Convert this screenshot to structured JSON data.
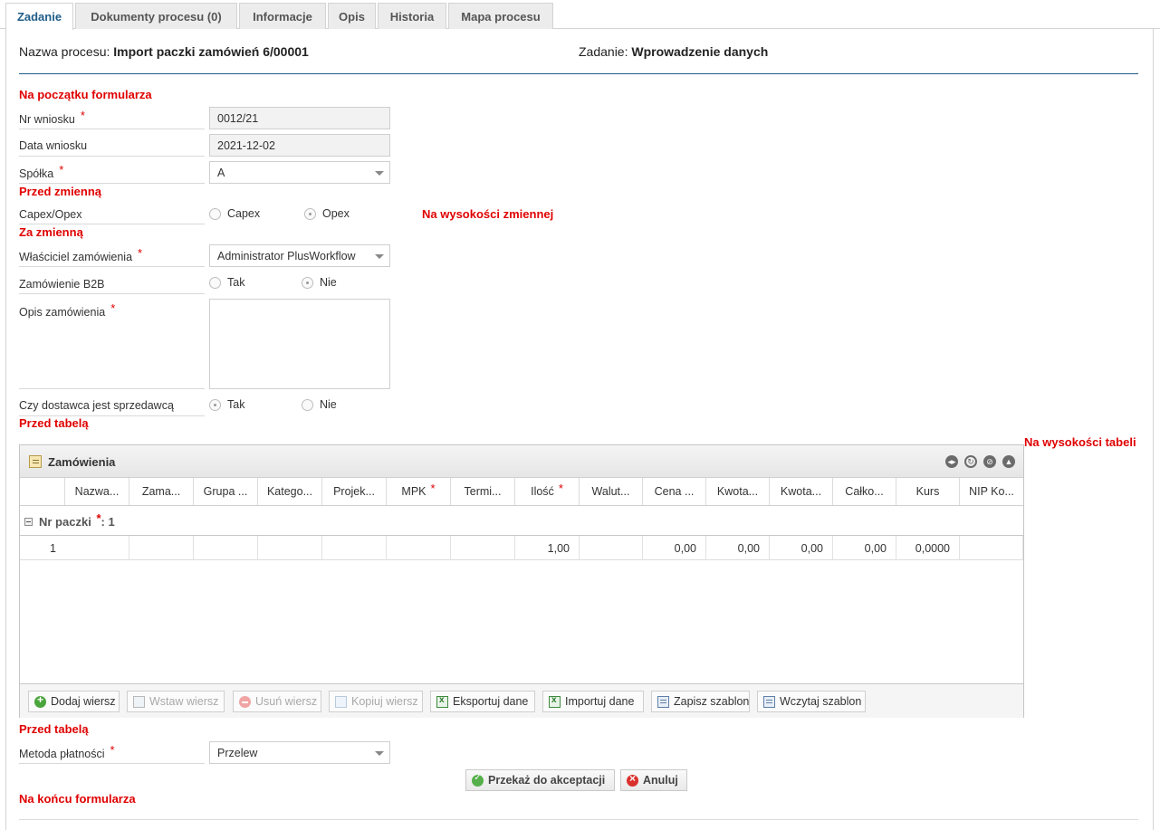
{
  "tabs": [
    {
      "label": "Zadanie",
      "active": true
    },
    {
      "label": "Dokumenty procesu (0)"
    },
    {
      "label": "Informacje"
    },
    {
      "label": "Opis"
    },
    {
      "label": "Historia"
    },
    {
      "label": "Mapa procesu"
    }
  ],
  "header": {
    "process_label": "Nazwa procesu:",
    "process_value": "Import paczki zamówień 6/00001",
    "task_label": "Zadanie:",
    "task_value": "Wprowadzenie danych"
  },
  "markers": {
    "form_start": "Na początku formularza",
    "before_variable": "Przed zmienną",
    "at_variable": "Na wysokości zmiennej",
    "after_variable": "Za zmienną",
    "before_table": "Przed tabelą",
    "at_table": "Na wysokości tabeli",
    "before_table_2": "Przed tabelą",
    "form_end": "Na końcu formularza"
  },
  "required_mark": "*",
  "form": {
    "nr_wniosku": {
      "label": "Nr wniosku",
      "value": "0012/21"
    },
    "data_wniosku": {
      "label": "Data wniosku",
      "value": "2021-12-02"
    },
    "spolka": {
      "label": "Spółka",
      "value": "A"
    },
    "capex_opex": {
      "label": "Capex/Opex",
      "options": [
        "Capex",
        "Opex"
      ],
      "selected": "Opex"
    },
    "wlasciciel": {
      "label": "Właściciel zamówienia",
      "value": "Administrator PlusWorkflow"
    },
    "b2b": {
      "label": "Zamówienie B2B",
      "options": [
        "Tak",
        "Nie"
      ],
      "selected": "Nie"
    },
    "opis": {
      "label": "Opis zamówienia",
      "value": ""
    },
    "dostawca": {
      "label": "Czy dostawca jest sprzedawcą",
      "options": [
        "Tak",
        "Nie"
      ],
      "selected": "Tak"
    },
    "metoda": {
      "label": "Metoda płatności",
      "value": "Przelew"
    }
  },
  "grid": {
    "title": "Zamówienia",
    "columns": [
      "Nazwa...",
      "Zama...",
      "Grupa ...",
      "Katego...",
      "Projek...",
      "MPK",
      "Termi...",
      "Ilość",
      "Walut...",
      "Cena ...",
      "Kwota...",
      "Kwota...",
      "Całko...",
      "Kurs",
      "NIP Ko..."
    ],
    "required_columns": [
      "MPK",
      "Ilość"
    ],
    "group": {
      "label": "Nr paczki",
      "value": ": 1"
    },
    "rows": [
      {
        "num": "1",
        "cells": [
          "",
          "",
          "",
          "",
          "",
          "",
          "",
          "1,00",
          "",
          "0,00",
          "0,00",
          "0,00",
          "0,00",
          "0,0000",
          ""
        ]
      }
    ],
    "buttons": [
      {
        "label": "Dodaj wiersz",
        "enabled": true,
        "icon": "add-icon"
      },
      {
        "label": "Wstaw wiersz",
        "enabled": false,
        "icon": "insert-row-icon"
      },
      {
        "label": "Usuń wiersz",
        "enabled": false,
        "icon": "remove-icon"
      },
      {
        "label": "Kopiuj wiersz",
        "enabled": false,
        "icon": "copy-icon"
      },
      {
        "label": "Eksportuj dane",
        "enabled": true,
        "icon": "excel-export-icon"
      },
      {
        "label": "Importuj dane",
        "enabled": true,
        "icon": "excel-import-icon"
      },
      {
        "label": "Zapisz szablon",
        "enabled": true,
        "icon": "save-template-icon"
      },
      {
        "label": "Wczytaj szablon",
        "enabled": true,
        "icon": "load-template-icon"
      }
    ]
  },
  "actions": {
    "accept": "Przekaż do akceptacji",
    "cancel": "Anuluj"
  },
  "colors": {
    "accent": "#1f5d8a",
    "marker": "#e00000"
  }
}
